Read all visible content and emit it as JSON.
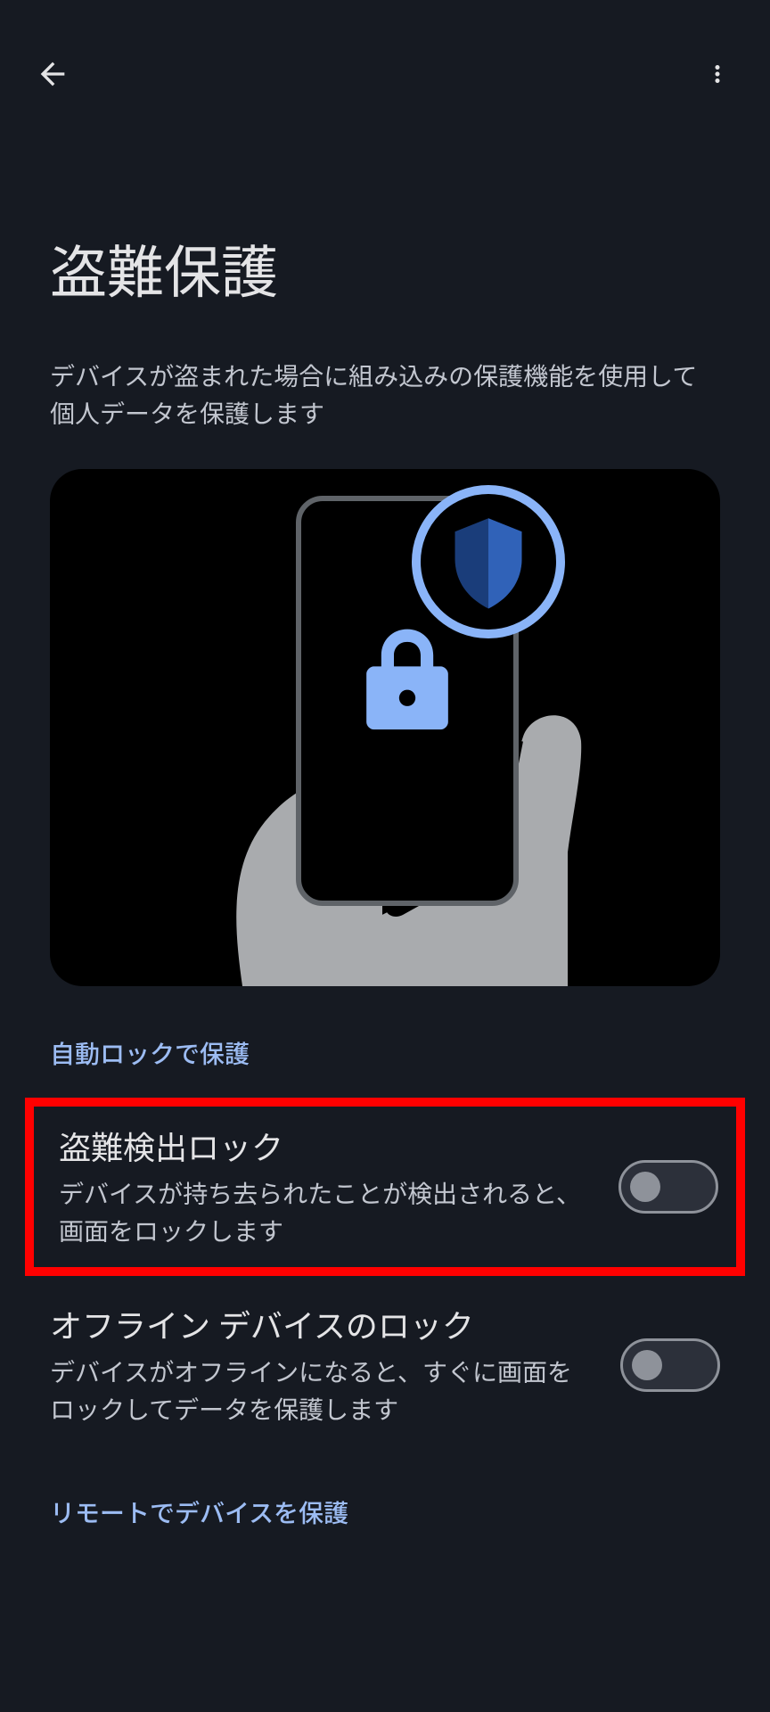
{
  "header": {
    "title": "盗難保護",
    "subtitle": "デバイスが盗まれた場合に組み込みの保護機能を使用して個人データを保護します"
  },
  "sections": {
    "autoLock": {
      "heading": "自動ロックで保護",
      "items": [
        {
          "title": "盗難検出ロック",
          "description": "デバイスが持ち去られたことが検出されると、画面をロックします",
          "enabled": false,
          "highlighted": true
        },
        {
          "title": "オフライン デバイスのロック",
          "description": "デバイスがオフラインになると、すぐに画面をロックしてデータを保護します",
          "enabled": false,
          "highlighted": false
        }
      ]
    },
    "remote": {
      "heading": "リモートでデバイスを保護"
    }
  },
  "colors": {
    "background": "#161a22",
    "text": "#e4e4e6",
    "subtext": "#c2c6cf",
    "link": "#9cbcf3",
    "highlight": "#ff0000",
    "toggleTrack": "#2c303a",
    "toggleBorder": "#8e929a",
    "iconBlue": "#8ab4f8",
    "shieldDark": "#1a3d7a"
  }
}
